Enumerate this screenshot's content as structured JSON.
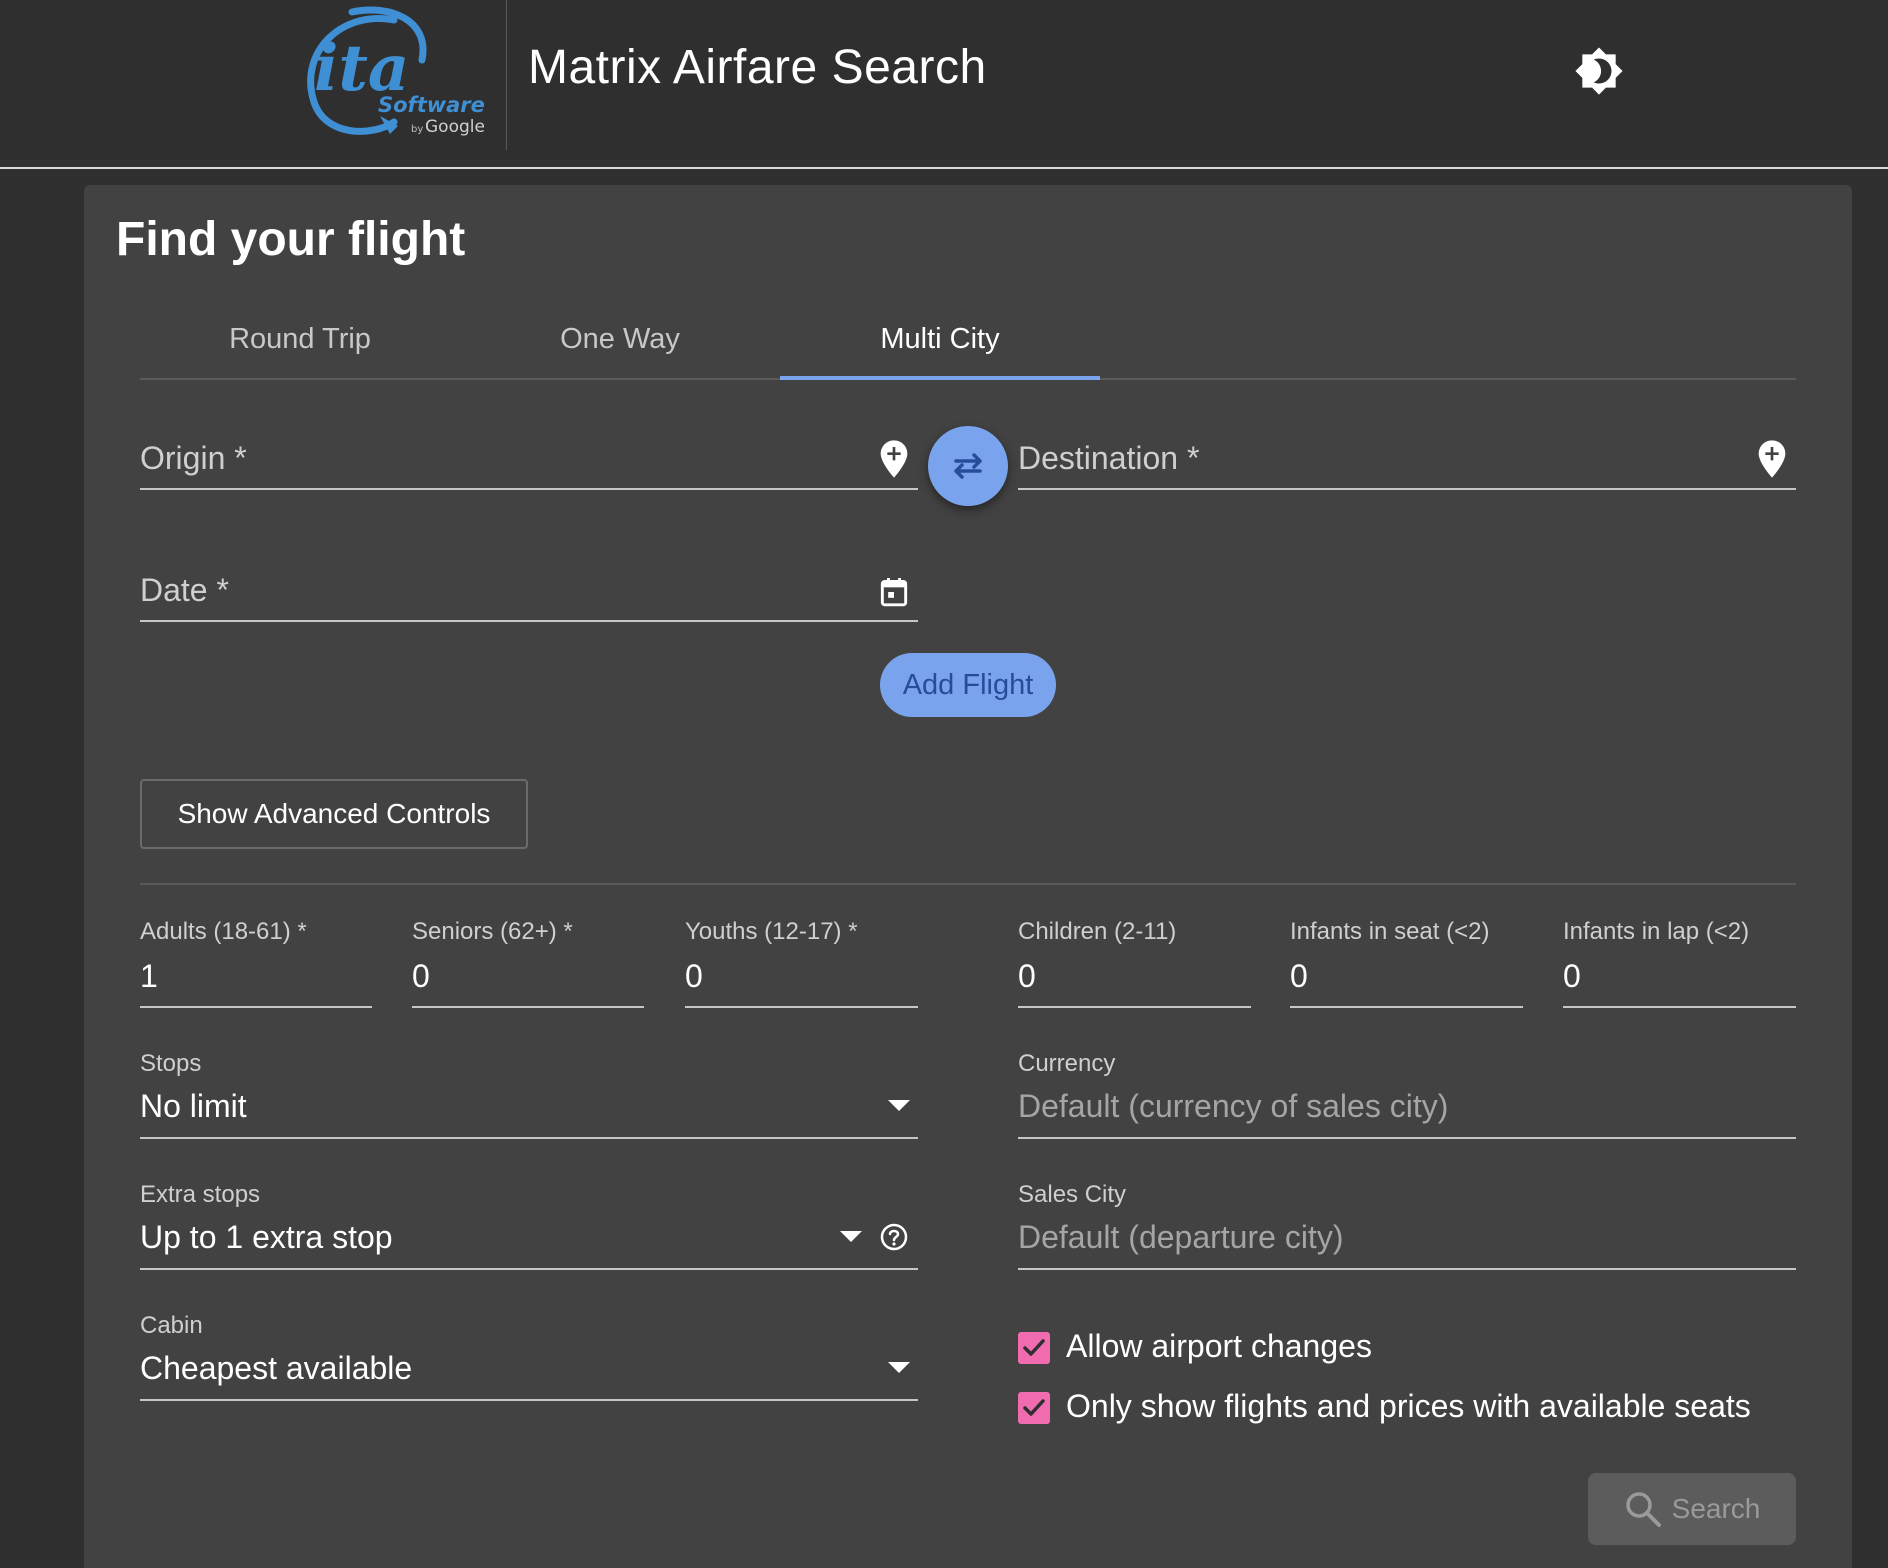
{
  "header": {
    "logo": {
      "main": "ita",
      "sub": "Software",
      "by": "by",
      "brand": "Google"
    },
    "title": "Matrix Airfare Search",
    "theme_icon": "brightness-icon"
  },
  "card": {
    "title": "Find your flight",
    "tabs": [
      {
        "label": "Round Trip",
        "active": false
      },
      {
        "label": "One Way",
        "active": false
      },
      {
        "label": "Multi City",
        "active": true
      }
    ]
  },
  "flight": {
    "origin": {
      "placeholder": "Origin *",
      "value": ""
    },
    "destination": {
      "placeholder": "Destination *",
      "value": ""
    },
    "date": {
      "placeholder": "Date *",
      "value": ""
    },
    "add_flight_label": "Add Flight"
  },
  "advanced_label": "Show Advanced Controls",
  "passengers": [
    {
      "label": "Adults (18-61) *",
      "value": "1"
    },
    {
      "label": "Seniors (62+) *",
      "value": "0"
    },
    {
      "label": "Youths (12-17) *",
      "value": "0"
    },
    {
      "label": "Children (2-11)",
      "value": "0"
    },
    {
      "label": "Infants in seat (<2)",
      "value": "0"
    },
    {
      "label": "Infants in lap (<2)",
      "value": "0"
    }
  ],
  "options": {
    "stops": {
      "label": "Stops",
      "value": "No limit"
    },
    "extra_stops": {
      "label": "Extra stops",
      "value": "Up to 1 extra stop"
    },
    "cabin": {
      "label": "Cabin",
      "value": "Cheapest available"
    },
    "currency": {
      "label": "Currency",
      "placeholder": "Default (currency of sales city)"
    },
    "sales_city": {
      "label": "Sales City",
      "placeholder": "Default (departure city)"
    },
    "allow_airport_changes": {
      "label": "Allow airport changes",
      "checked": true
    },
    "available_seats_only": {
      "label": "Only show flights and prices with available seats",
      "checked": true
    }
  },
  "search_label": "Search",
  "colors": {
    "accent": "#7aa3ee",
    "checkbox": "#f06bb0",
    "background": "#2f2f2f",
    "card": "#424242"
  }
}
